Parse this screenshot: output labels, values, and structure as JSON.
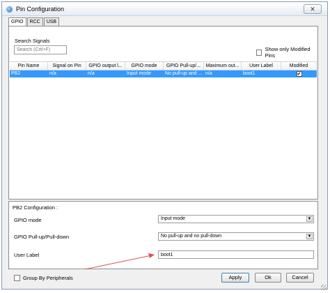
{
  "window": {
    "title": "Pin Configuration",
    "close_icon": "close-icon"
  },
  "tabs": [
    {
      "label": "GPIO",
      "active": true
    },
    {
      "label": "RCC",
      "active": false
    },
    {
      "label": "USB",
      "active": false
    }
  ],
  "search": {
    "label": "Search Signals",
    "placeholder": "Search (Crtl+F)",
    "value": ""
  },
  "show_modified": {
    "label": "Show only Modified Pins",
    "checked": false
  },
  "table": {
    "headers": [
      "Pin Name",
      "Signal on Pin",
      "GPIO output l...",
      "GPIO mode",
      "GPIO Pull-up/...",
      "Maximum out...",
      "User Label",
      "Modified"
    ],
    "rows": [
      {
        "pin_name": "PB2",
        "signal": "n/a",
        "gpio_output": "n/a",
        "gpio_mode": "Input mode",
        "gpio_pull": "No pull-up and ...",
        "max_output": "n/a",
        "user_label": "boot1",
        "modified": true
      }
    ],
    "selected_row_color": "#3399ff"
  },
  "config": {
    "title": "PB2 Configuration :",
    "gpio_mode_label": "GPIO mode",
    "gpio_mode_value": "Input mode",
    "gpio_pull_label": "GPIO Pull-up/Pull-down",
    "gpio_pull_value": "No pull-up and no pull-down",
    "user_label_label": "User Label",
    "user_label_value": "boot1"
  },
  "annotation": {
    "arrow_color": "#d9534f"
  },
  "footer": {
    "group_by_label": "Group By Peripherals",
    "group_by_checked": false,
    "apply_label": "Apply",
    "ok_label": "Ok",
    "cancel_label": "Cancel"
  }
}
